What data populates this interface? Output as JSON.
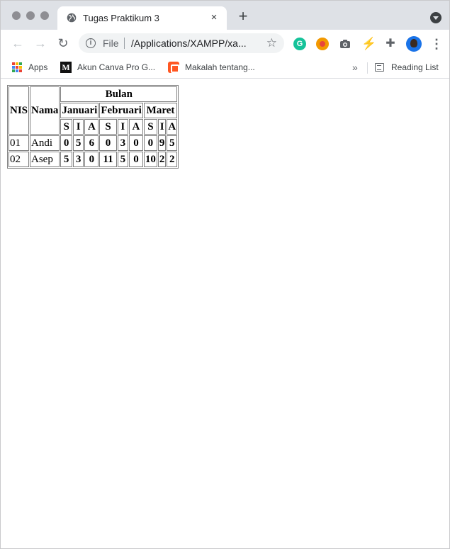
{
  "browser": {
    "tab_title": "Tugas Praktikum 3",
    "tab_close": "×",
    "new_tab": "+",
    "omnibox": {
      "scheme": "File",
      "url": "/Applications/XAMPP/xa..."
    },
    "extensions": {
      "grammarly": "G"
    },
    "bookmarks": [
      {
        "label": "Apps",
        "icon": "apps-grid-icon"
      },
      {
        "label": "Akun Canva Pro G...",
        "icon": "medium-m-icon"
      },
      {
        "label": "Makalah tentang...",
        "icon": "blogger-icon"
      }
    ],
    "overflow": "»",
    "reading_list": "Reading List"
  },
  "table": {
    "header_nis": "NIS",
    "header_nama": "Nama",
    "header_bulan": "Bulan",
    "months": [
      "Januari",
      "Februari",
      "Maret"
    ],
    "sub_cols": [
      "S",
      "I",
      "A"
    ],
    "rows": [
      {
        "nis": "01",
        "nama": "Andi",
        "values": [
          "0",
          "5",
          "6",
          "0",
          "3",
          "0",
          "0",
          "9",
          "5"
        ]
      },
      {
        "nis": "02",
        "nama": "Asep",
        "values": [
          "5",
          "3",
          "0",
          "11",
          "5",
          "0",
          "10",
          "2",
          "2"
        ]
      }
    ]
  }
}
